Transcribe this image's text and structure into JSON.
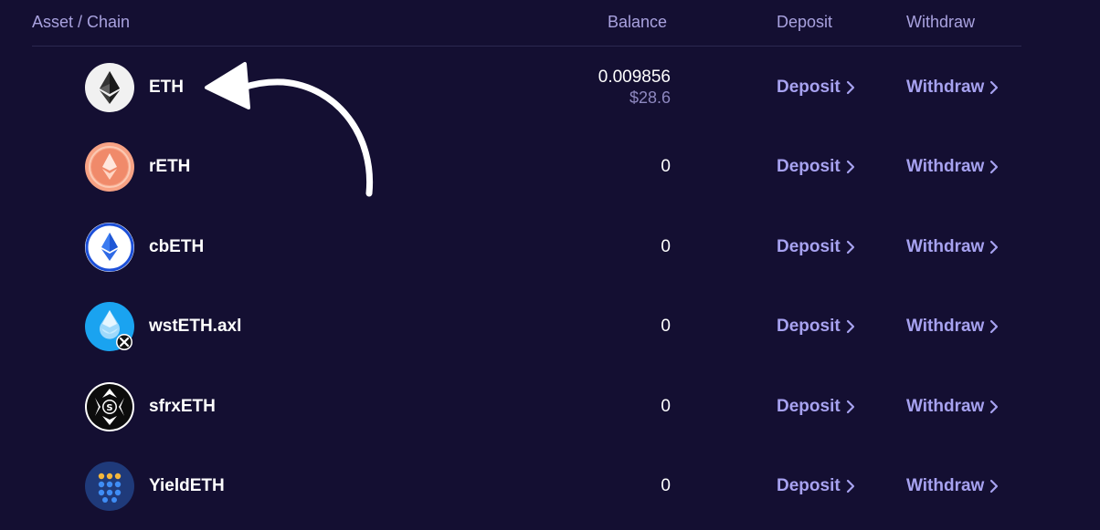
{
  "header": {
    "asset_chain": "Asset / Chain",
    "balance": "Balance",
    "deposit": "Deposit",
    "withdraw": "Withdraw"
  },
  "rows": [
    {
      "name": "ETH",
      "balance": "0.009856",
      "balance_usd": "$28.6",
      "deposit": "Deposit",
      "withdraw": "Withdraw",
      "icon": "eth-icon"
    },
    {
      "name": "rETH",
      "balance": "0",
      "deposit": "Deposit",
      "withdraw": "Withdraw",
      "icon": "reth-icon"
    },
    {
      "name": "cbETH",
      "balance": "0",
      "deposit": "Deposit",
      "withdraw": "Withdraw",
      "icon": "cbeth-icon"
    },
    {
      "name": "wstETH.axl",
      "balance": "0",
      "deposit": "Deposit",
      "withdraw": "Withdraw",
      "icon": "wsteth-axl-icon"
    },
    {
      "name": "sfrxETH",
      "balance": "0",
      "deposit": "Deposit",
      "withdraw": "Withdraw",
      "icon": "sfrxeth-icon"
    },
    {
      "name": "YieldETH",
      "balance": "0",
      "deposit": "Deposit",
      "withdraw": "Withdraw",
      "icon": "yieldeth-icon"
    }
  ],
  "colors": {
    "background": "#140f32",
    "header_text": "#a9a2df",
    "action_text": "#a7a2f0",
    "value_text": "#ffffff",
    "muted_text": "#8e88c0"
  }
}
